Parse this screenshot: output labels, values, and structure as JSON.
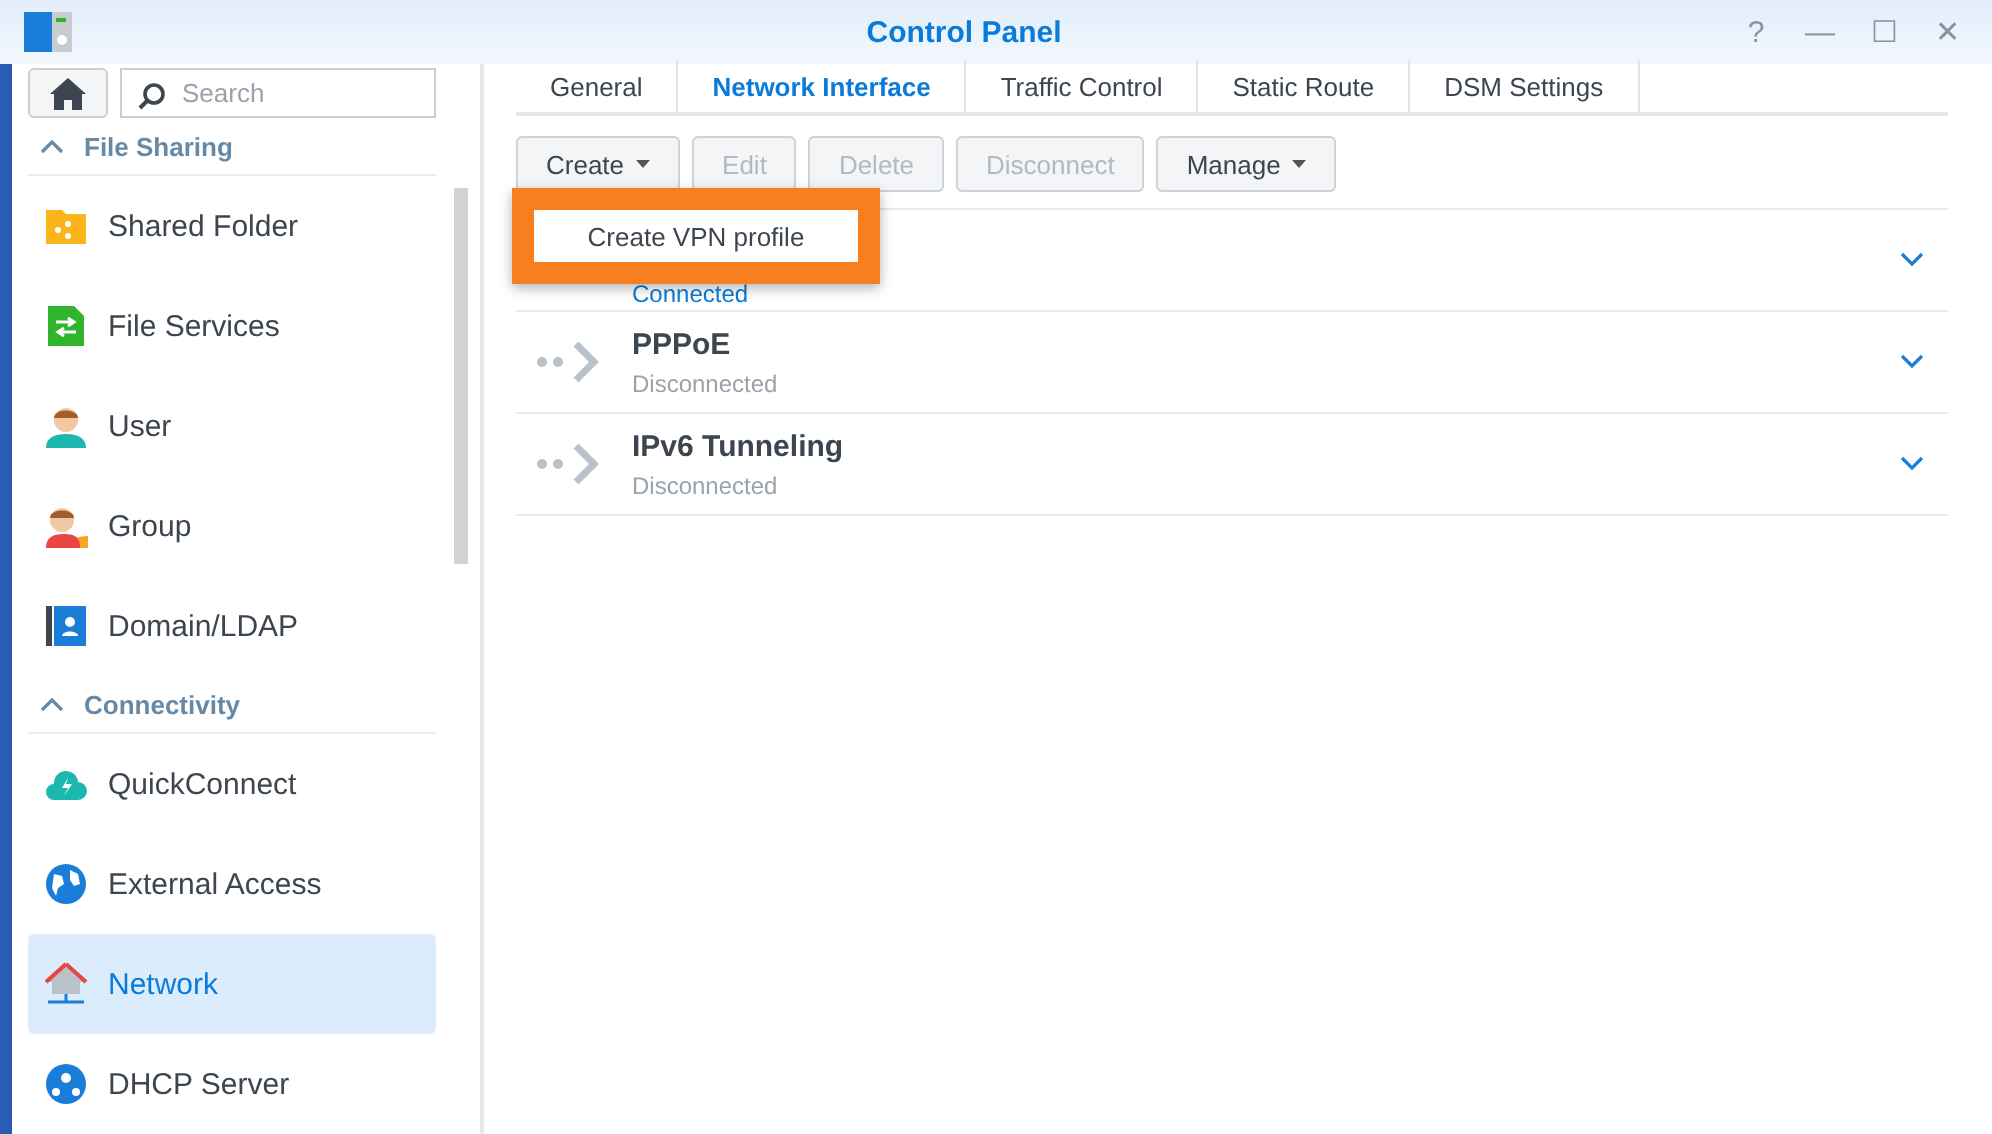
{
  "window": {
    "title": "Control Panel",
    "controls": [
      "?",
      "—",
      "☐",
      "✕"
    ]
  },
  "search": {
    "placeholder": "Search"
  },
  "sidebar": {
    "sections": [
      {
        "title": "File Sharing",
        "expanded": true,
        "items": [
          {
            "label": "Shared Folder",
            "selected": false
          },
          {
            "label": "File Services",
            "selected": false
          },
          {
            "label": "User",
            "selected": false
          },
          {
            "label": "Group",
            "selected": false
          },
          {
            "label": "Domain/LDAP",
            "selected": false
          }
        ]
      },
      {
        "title": "Connectivity",
        "expanded": true,
        "items": [
          {
            "label": "QuickConnect",
            "selected": false
          },
          {
            "label": "External Access",
            "selected": false
          },
          {
            "label": "Network",
            "selected": true
          },
          {
            "label": "DHCP Server",
            "selected": false
          }
        ]
      }
    ]
  },
  "tabs": [
    {
      "label": "General",
      "selected": false
    },
    {
      "label": "Network Interface",
      "selected": true
    },
    {
      "label": "Traffic Control",
      "selected": false
    },
    {
      "label": "Static Route",
      "selected": false
    },
    {
      "label": "DSM Settings",
      "selected": false
    }
  ],
  "toolbar": [
    {
      "label": "Create",
      "disabled": false,
      "dropdown": true
    },
    {
      "label": "Edit",
      "disabled": true,
      "dropdown": false
    },
    {
      "label": "Delete",
      "disabled": true,
      "dropdown": false
    },
    {
      "label": "Disconnect",
      "disabled": true,
      "dropdown": false
    },
    {
      "label": "Manage",
      "disabled": false,
      "dropdown": true
    }
  ],
  "menu": {
    "items": [
      "Create VPN profile"
    ],
    "highlighted": true
  },
  "interfaces": [
    {
      "status": "Connected",
      "connected": true
    },
    {
      "name": "PPPoE",
      "status": "Disconnected",
      "connected": false
    },
    {
      "name": "IPv6 Tunneling",
      "status": "Disconnected",
      "connected": false
    }
  ]
}
